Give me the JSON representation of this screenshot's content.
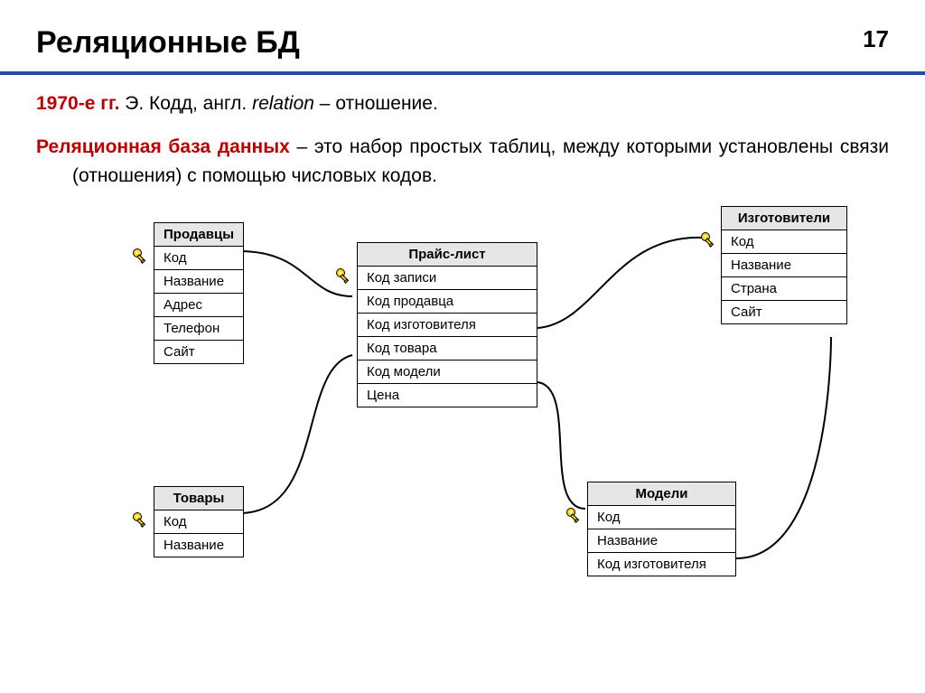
{
  "pageNumber": "17",
  "title": "Реляционные БД",
  "intro": {
    "era": "1970-е гг.",
    "rest": " Э. Кодд, англ. ",
    "italic": "relation",
    "after": " – отношение."
  },
  "definition": {
    "term": "Реляционная база данных",
    "body": " – это набор простых таблиц, между которыми установлены связи (отношения) с помощью числовых кодов."
  },
  "tables": {
    "sellers": {
      "title": "Продавцы",
      "rows": [
        "Код",
        "Название",
        "Адрес",
        "Телефон",
        "Сайт"
      ]
    },
    "pricelist": {
      "title": "Прайс-лист",
      "rows": [
        "Код записи",
        "Код продавца",
        "Код изготовителя",
        "Код товара",
        "Код модели",
        "Цена"
      ]
    },
    "makers": {
      "title": "Изготовители",
      "rows": [
        "Код",
        "Название",
        "Страна",
        "Сайт"
      ]
    },
    "goods": {
      "title": "Товары",
      "rows": [
        "Код",
        "Название"
      ]
    },
    "models": {
      "title": "Модели",
      "rows": [
        "Код",
        "Название",
        "Код изготовителя"
      ]
    }
  }
}
